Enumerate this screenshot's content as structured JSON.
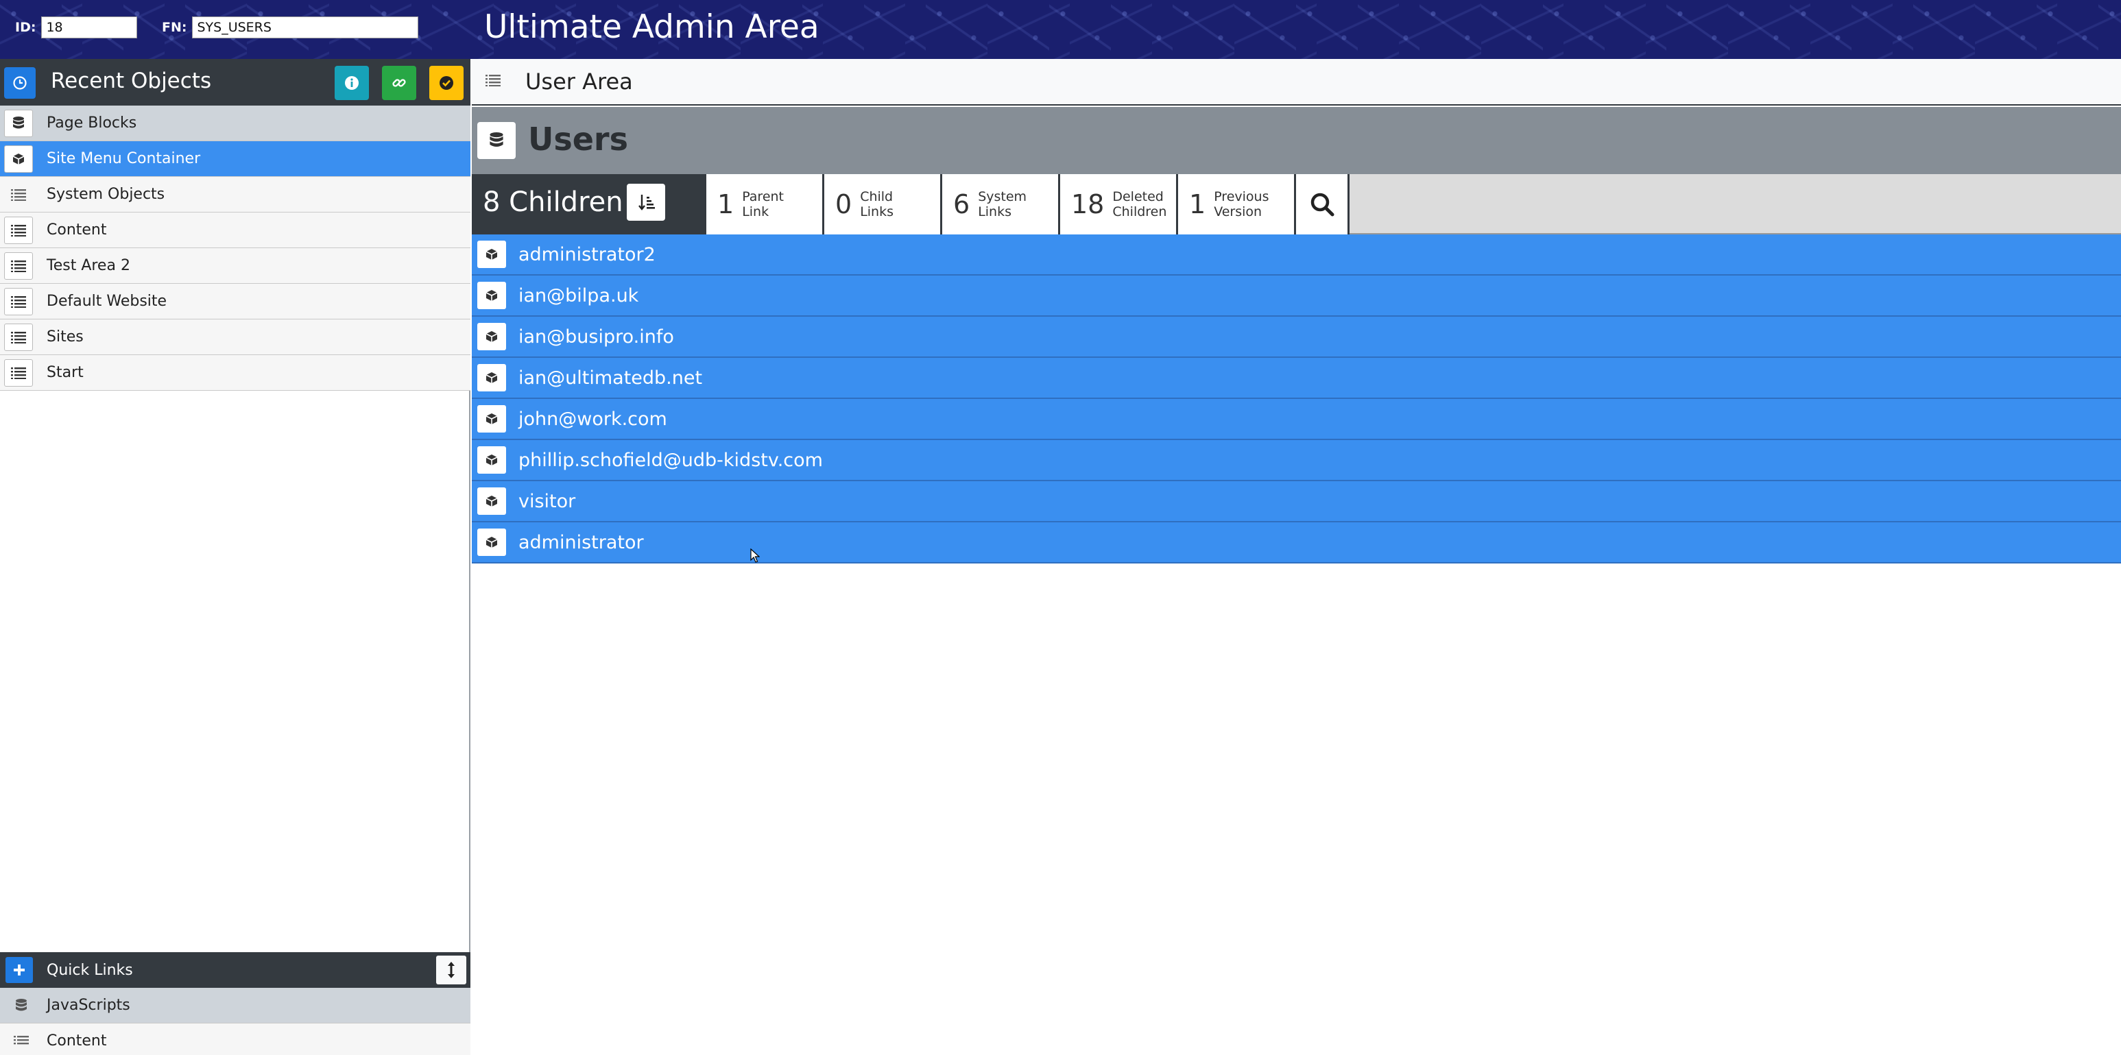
{
  "header": {
    "id_label": "ID:",
    "id_value": "18",
    "fn_label": "FN:",
    "fn_value": "SYS_USERS",
    "app_title": "Ultimate Admin Area"
  },
  "sidebar": {
    "title": "Recent Objects",
    "buttons": [
      "info-icon",
      "link-icon",
      "check-icon"
    ],
    "items": [
      {
        "label": "Page Blocks",
        "icon": "database-icon",
        "state": "grey"
      },
      {
        "label": "Site Menu Container",
        "icon": "cube-icon",
        "state": "active"
      },
      {
        "label": "System Objects",
        "icon": "list-icon",
        "state": "normal"
      },
      {
        "label": "Content",
        "icon": "list-icon",
        "state": "normal"
      },
      {
        "label": "Test Area 2",
        "icon": "list-icon",
        "state": "normal"
      },
      {
        "label": "Default Website",
        "icon": "list-icon",
        "state": "normal"
      },
      {
        "label": "Sites",
        "icon": "list-icon",
        "state": "normal"
      },
      {
        "label": "Start",
        "icon": "list-icon",
        "state": "normal"
      }
    ],
    "quick_links": {
      "title": "Quick Links",
      "items": [
        {
          "label": "JavaScripts",
          "icon": "database-icon"
        },
        {
          "label": "Content",
          "icon": "list-icon"
        }
      ]
    }
  },
  "main": {
    "breadcrumb": "User Area",
    "object_title": "Users",
    "tabs": {
      "children": {
        "count": "8",
        "label": "Children"
      },
      "items": [
        {
          "n": "1",
          "line1": "Parent",
          "line2": "Link"
        },
        {
          "n": "0",
          "line1": "Child",
          "line2": "Links"
        },
        {
          "n": "6",
          "line1": "System",
          "line2": "Links"
        },
        {
          "n": "18",
          "line1": "Deleted",
          "line2": "Children"
        },
        {
          "n": "1",
          "line1": "Previous",
          "line2": "Version"
        }
      ]
    },
    "children": [
      "administrator2",
      "ian@bilpa.uk",
      "ian@busipro.info",
      "ian@ultimatedb.net",
      "john@work.com",
      "phillip.schofield@udb-kidstv.com",
      "visitor",
      "administrator"
    ]
  },
  "colors": {
    "header_bg": "#1a1f6e",
    "dark": "#343a40",
    "active_blue": "#3a8ff0",
    "info": "#17a2b8",
    "success": "#28a745",
    "warning": "#ffc107"
  }
}
